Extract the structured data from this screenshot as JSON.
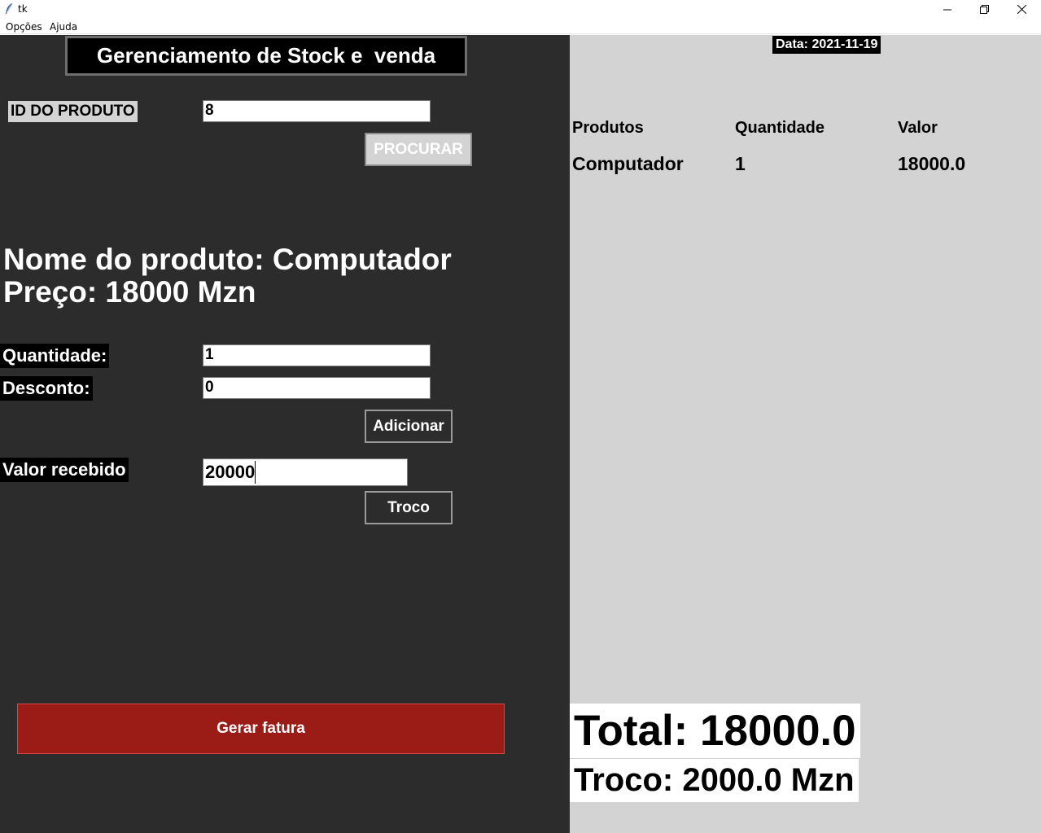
{
  "window": {
    "title": "tk",
    "controls": {
      "minimize": "minimize-icon",
      "maximize": "restore-icon",
      "close": "close-icon"
    }
  },
  "menu": {
    "items": [
      "Opções",
      "Ajuda"
    ]
  },
  "left": {
    "title": "Gerenciamento de Stock e  venda",
    "id_label": "ID DO PRODUTO",
    "id_value": "8",
    "search_button": "PROCURAR",
    "product_name": "Nome do produto: Computador",
    "product_price": "Preço: 18000 Mzn",
    "quantity_label": "Quantidade:",
    "quantity_value": "1",
    "discount_label": "Desconto:",
    "discount_value": "0",
    "add_button": "Adicionar",
    "received_label": "Valor recebido",
    "received_value": "20000",
    "change_button": "Troco",
    "invoice_button": "Gerar fatura"
  },
  "right": {
    "date": "Data: 2021-11-19",
    "table": {
      "headers": [
        "Produtos",
        "Quantidade",
        "Valor"
      ],
      "rows": [
        [
          "Computador",
          "1",
          "18000.0"
        ]
      ]
    },
    "total": "Total: 18000.0",
    "change": "Troco: 2000.0 Mzn"
  },
  "colors": {
    "left_bg": "#2c2c2c",
    "right_bg": "#d3d3d3",
    "invoice_button": "#9b1b17"
  }
}
